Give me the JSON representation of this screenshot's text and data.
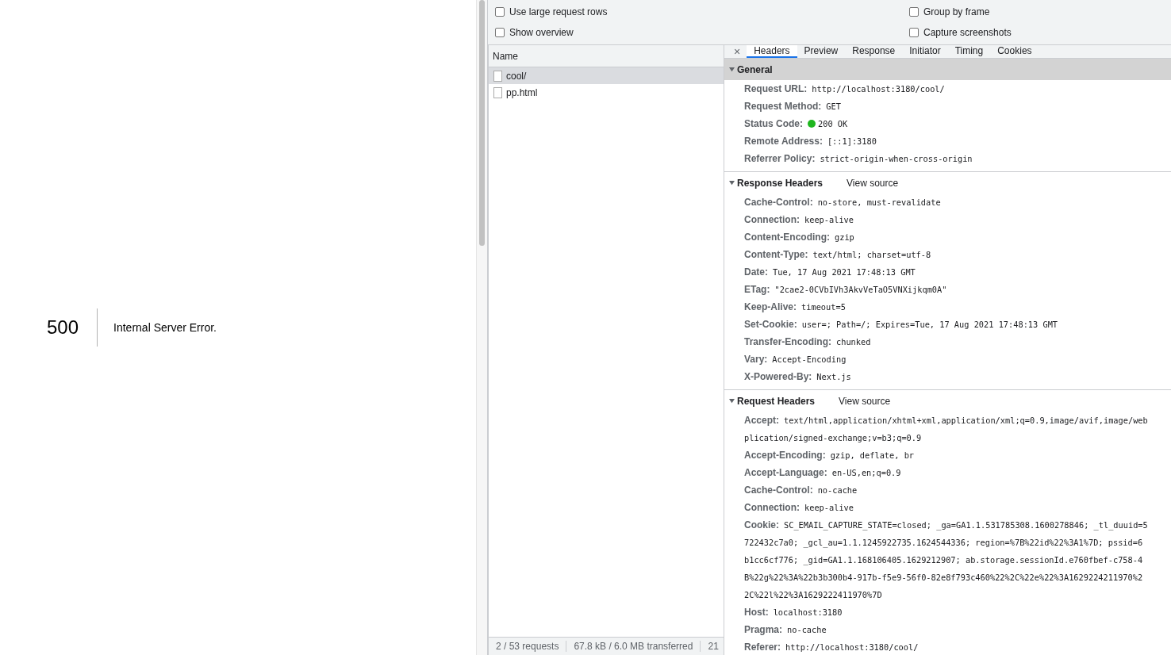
{
  "page": {
    "code": "500",
    "message": "Internal Server Error."
  },
  "settings": [
    {
      "label": "Use large request rows",
      "checked": false
    },
    {
      "label": "Group by frame",
      "checked": false
    },
    {
      "label": "Show overview",
      "checked": false
    },
    {
      "label": "Capture screenshots",
      "checked": false
    }
  ],
  "requests": {
    "column": "Name",
    "rows": [
      {
        "name": "cool/",
        "selected": true
      },
      {
        "name": "pp.html",
        "selected": false
      }
    ]
  },
  "status_bar": [
    "2 / 53 requests",
    "67.8 kB / 6.0 MB transferred",
    "21"
  ],
  "detail_tabs": {
    "close": "×",
    "tabs": [
      {
        "label": "Headers",
        "selected": true
      },
      {
        "label": "Preview",
        "selected": false
      },
      {
        "label": "Response",
        "selected": false
      },
      {
        "label": "Initiator",
        "selected": false
      },
      {
        "label": "Timing",
        "selected": false
      },
      {
        "label": "Cookies",
        "selected": false
      }
    ]
  },
  "sections": [
    {
      "title": "General",
      "expanded": true,
      "highlighted": true,
      "headers": [
        {
          "name": "Request URL:",
          "lines": [
            "http://localhost:3180/cool/"
          ]
        },
        {
          "name": "Request Method:",
          "lines": [
            "GET"
          ]
        },
        {
          "name": "Status Code:",
          "lines": [
            "200 OK"
          ],
          "color": "#1fb61f"
        },
        {
          "name": "Remote Address:",
          "lines": [
            "[::1]:3180"
          ]
        },
        {
          "name": "Referrer Policy:",
          "lines": [
            "strict-origin-when-cross-origin"
          ]
        }
      ]
    },
    {
      "title": "Response Headers",
      "link": "View source",
      "expanded": true,
      "highlighted": false,
      "headers": [
        {
          "name": "Cache-Control:",
          "lines": [
            "no-store, must-revalidate"
          ]
        },
        {
          "name": "Connection:",
          "lines": [
            "keep-alive"
          ]
        },
        {
          "name": "Content-Encoding:",
          "lines": [
            "gzip"
          ]
        },
        {
          "name": "Content-Type:",
          "lines": [
            "text/html; charset=utf-8"
          ]
        },
        {
          "name": "Date:",
          "lines": [
            "Tue, 17 Aug 2021 17:48:13 GMT"
          ]
        },
        {
          "name": "ETag:",
          "lines": [
            "\"2cae2-0CVbIVh3AkvVeTaO5VNXijkqm0A\""
          ]
        },
        {
          "name": "Keep-Alive:",
          "lines": [
            "timeout=5"
          ]
        },
        {
          "name": "Set-Cookie:",
          "lines": [
            "user=; Path=/; Expires=Tue, 17 Aug 2021 17:48:13 GMT"
          ]
        },
        {
          "name": "Transfer-Encoding:",
          "lines": [
            "chunked"
          ]
        },
        {
          "name": "Vary:",
          "lines": [
            "Accept-Encoding"
          ]
        },
        {
          "name": "X-Powered-By:",
          "lines": [
            "Next.js"
          ]
        }
      ]
    },
    {
      "title": "Request Headers",
      "link": "View source",
      "expanded": true,
      "highlighted": false,
      "headers": [
        {
          "name": "Accept:",
          "lines": [
            "text/html,application/xhtml+xml,application/xml;q=0.9,image/avif,image/web",
            "plication/signed-exchange;v=b3;q=0.9"
          ]
        },
        {
          "name": "Accept-Encoding:",
          "lines": [
            "gzip, deflate, br"
          ]
        },
        {
          "name": "Accept-Language:",
          "lines": [
            "en-US,en;q=0.9"
          ]
        },
        {
          "name": "Cache-Control:",
          "lines": [
            "no-cache"
          ]
        },
        {
          "name": "Connection:",
          "lines": [
            "keep-alive"
          ]
        },
        {
          "name": "Cookie:",
          "lines": [
            "SC_EMAIL_CAPTURE_STATE=closed; _ga=GA1.1.531785308.1600278846; _tl_duuid=5",
            "722432c7a0; _gcl_au=1.1.1245922735.1624544336; region=%7B%22id%22%3A1%7D; pssid=6",
            "b1cc6cf776; _gid=GA1.1.168106405.1629212907; ab.storage.sessionId.e760fbef-c758-4",
            "B%22g%22%3A%22b3b300b4-917b-f5e9-56f0-82e8f793c460%22%2C%22e%22%3A1629224211970%2",
            "2C%22l%22%3A1629222411970%7D"
          ]
        },
        {
          "name": "Host:",
          "lines": [
            "localhost:3180"
          ]
        },
        {
          "name": "Pragma:",
          "lines": [
            "no-cache"
          ]
        },
        {
          "name": "Referer:",
          "lines": [
            "http://localhost:3180/cool/"
          ]
        }
      ]
    }
  ]
}
